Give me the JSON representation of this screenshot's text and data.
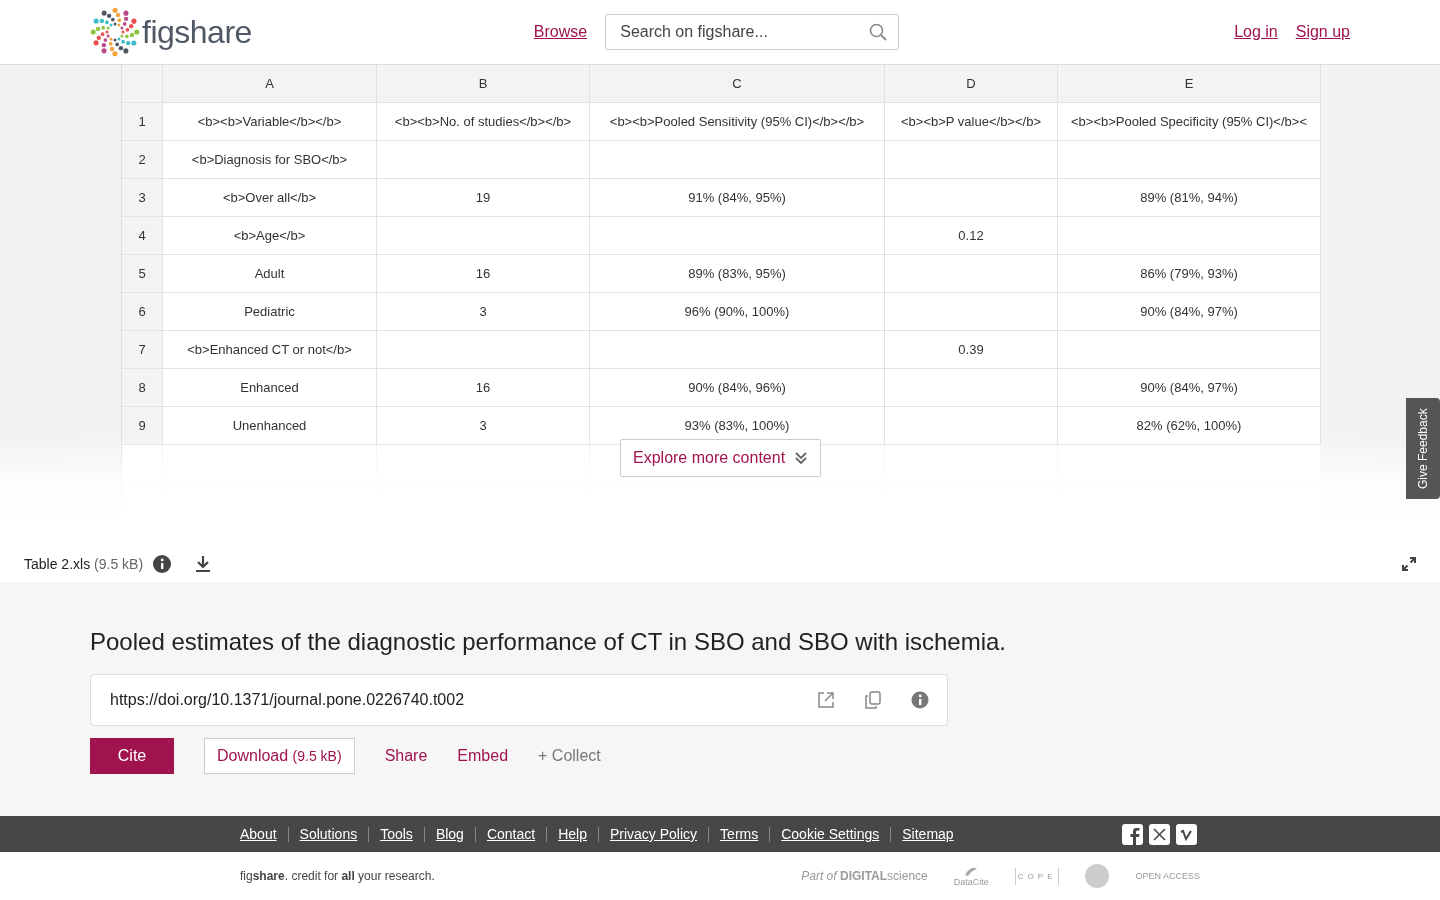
{
  "header": {
    "logo": "figshare",
    "nav_link": "Browse",
    "search": {
      "placeholder": "Search on figshare..."
    },
    "auth_links": [
      "Log in",
      "Sign up"
    ]
  },
  "table": {
    "columns": [
      "A",
      "B",
      "C",
      "D",
      "E"
    ],
    "rows": [
      {
        "number": "1",
        "cells": [
          "<b><b>Variable</b></b>",
          "<b><b>No. of studies</b></b>",
          "<b><b>Pooled Sensitivity (95% CI)</b></b>",
          "<b><b>P value</b></b>",
          "<b><b>Pooled Specificity (95% CI)</b><"
        ]
      },
      {
        "number": "2",
        "cells": [
          "<b>Diagnosis for SBO</b>",
          "",
          "",
          "",
          ""
        ]
      },
      {
        "number": "3",
        "cells": [
          "<b>Over all</b>",
          "19",
          "91% (84%, 95%)",
          "",
          "89% (81%, 94%)"
        ]
      },
      {
        "number": "4",
        "cells": [
          "<b>Age</b>",
          "",
          "",
          "0.12",
          ""
        ]
      },
      {
        "number": "5",
        "cells": [
          "Adult",
          "16",
          "89% (83%, 95%)",
          "",
          "86% (79%, 93%)"
        ]
      },
      {
        "number": "6",
        "cells": [
          "Pediatric",
          "3",
          "96% (90%, 100%)",
          "",
          "90% (84%, 97%)"
        ]
      },
      {
        "number": "7",
        "cells": [
          "<b>Enhanced CT or not</b>",
          "",
          "",
          "0.39",
          ""
        ]
      },
      {
        "number": "8",
        "cells": [
          "Enhanced",
          "16",
          "90% (84%, 96%)",
          "",
          "90% (84%, 97%)"
        ]
      },
      {
        "number": "9",
        "cells": [
          "Unenhanced",
          "3",
          "93% (83%, 100%)",
          "",
          "82% (62%, 100%)"
        ]
      }
    ]
  },
  "explore_button": "Explore more content",
  "feedback_tab": "Give Feedback",
  "file_bar": {
    "name": "Table 2.xls",
    "size": "(9.5 kB)"
  },
  "title": "Pooled estimates of the diagnostic performance of CT in SBO and SBO with ischemia.",
  "doi": "https://doi.org/10.1371/journal.pone.0226740.t002",
  "actions": {
    "cite": "Cite",
    "download": {
      "label": "Download",
      "size": "(9.5 kB)"
    },
    "share": "Share",
    "embed": "Embed",
    "collect": "+ Collect"
  },
  "footer": {
    "links": [
      "About",
      "Solutions",
      "Tools",
      "Blog",
      "Contact",
      "Help",
      "Privacy Policy",
      "Terms",
      "Cookie Settings",
      "Sitemap"
    ],
    "tagline": "fig**share**. credit for **all** your research.",
    "partners": [
      {
        "kind": "digital-science",
        "text": "*Part of* **DIGITAL**science"
      },
      {
        "kind": "datacite",
        "text": "DataCite"
      },
      {
        "kind": "cope",
        "text": "COPE"
      },
      {
        "kind": "seal"
      },
      {
        "kind": "open-access",
        "text": "OPEN ACCESS"
      }
    ]
  }
}
